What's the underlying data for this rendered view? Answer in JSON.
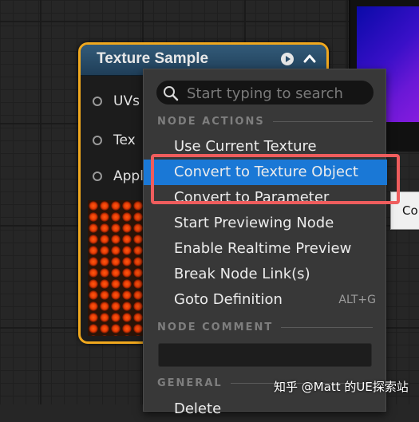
{
  "node": {
    "title": "Texture Sample",
    "pins": [
      {
        "label": "UVs"
      },
      {
        "label": "Tex"
      },
      {
        "label": "Appl"
      }
    ]
  },
  "side_tooltip": {
    "text": "Co"
  },
  "menu": {
    "search": {
      "placeholder": "Start typing to search",
      "value": ""
    },
    "sections": {
      "node_actions": "NODE ACTIONS",
      "node_comment": "NODE COMMENT",
      "general": "GENERAL"
    },
    "items": [
      {
        "label": "Use Current Texture"
      },
      {
        "label": "Convert to Texture Object",
        "selected": true
      },
      {
        "label": "Convert to Parameter"
      },
      {
        "label": "Start Previewing Node"
      },
      {
        "label": "Enable Realtime Preview"
      },
      {
        "label": "Break Node Link(s)"
      },
      {
        "label": "Goto Definition",
        "shortcut": "ALT+G"
      }
    ],
    "partial_item": "Delete"
  },
  "watermark": "知乎 @Matt 的UE探索站",
  "colors": {
    "node_border": "#f0a81e",
    "node_header": "#2a4d6a",
    "menu_bg": "#383838",
    "selection": "#1a78d6",
    "highlight": "#ef5d5d"
  },
  "icons": {
    "play": "play-icon",
    "collapse": "chevron-up-icon",
    "search": "search-icon"
  }
}
